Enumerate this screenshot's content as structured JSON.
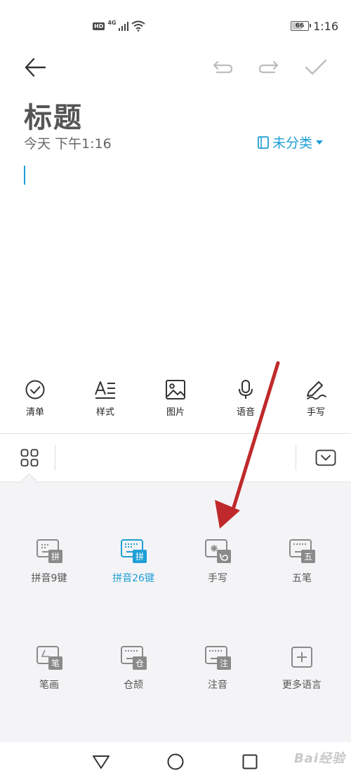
{
  "status_bar": {
    "hd": "HD",
    "network": "4G",
    "battery": "66",
    "battery_level": 0.66,
    "time": "1:16"
  },
  "note": {
    "title": "标题",
    "date": "今天 下午1:16",
    "category": "未分类"
  },
  "format_toolbar": {
    "items": [
      {
        "label": "清单",
        "icon": "checklist-icon"
      },
      {
        "label": "样式",
        "icon": "text-style-icon"
      },
      {
        "label": "图片",
        "icon": "image-icon"
      },
      {
        "label": "语音",
        "icon": "microphone-icon"
      },
      {
        "label": "手写",
        "icon": "pen-icon"
      }
    ]
  },
  "keyboards": {
    "items": [
      {
        "label": "拼音9键",
        "badge": "拼",
        "active": false
      },
      {
        "label": "拼音26键",
        "badge": "拼",
        "active": true
      },
      {
        "label": "手写",
        "badge": "",
        "active": false
      },
      {
        "label": "五笔",
        "badge": "五",
        "active": false
      },
      {
        "label": "笔画",
        "badge": "笔",
        "active": false
      },
      {
        "label": "仓颉",
        "badge": "仓",
        "active": false
      },
      {
        "label": "注音",
        "badge": "注",
        "active": false
      },
      {
        "label": "更多语言",
        "badge": "",
        "active": false
      }
    ]
  },
  "watermark": "Bai经验",
  "colors": {
    "accent": "#1e9fd6",
    "arrow": "#c0292b",
    "icon_gray": "#8a8a8a"
  }
}
